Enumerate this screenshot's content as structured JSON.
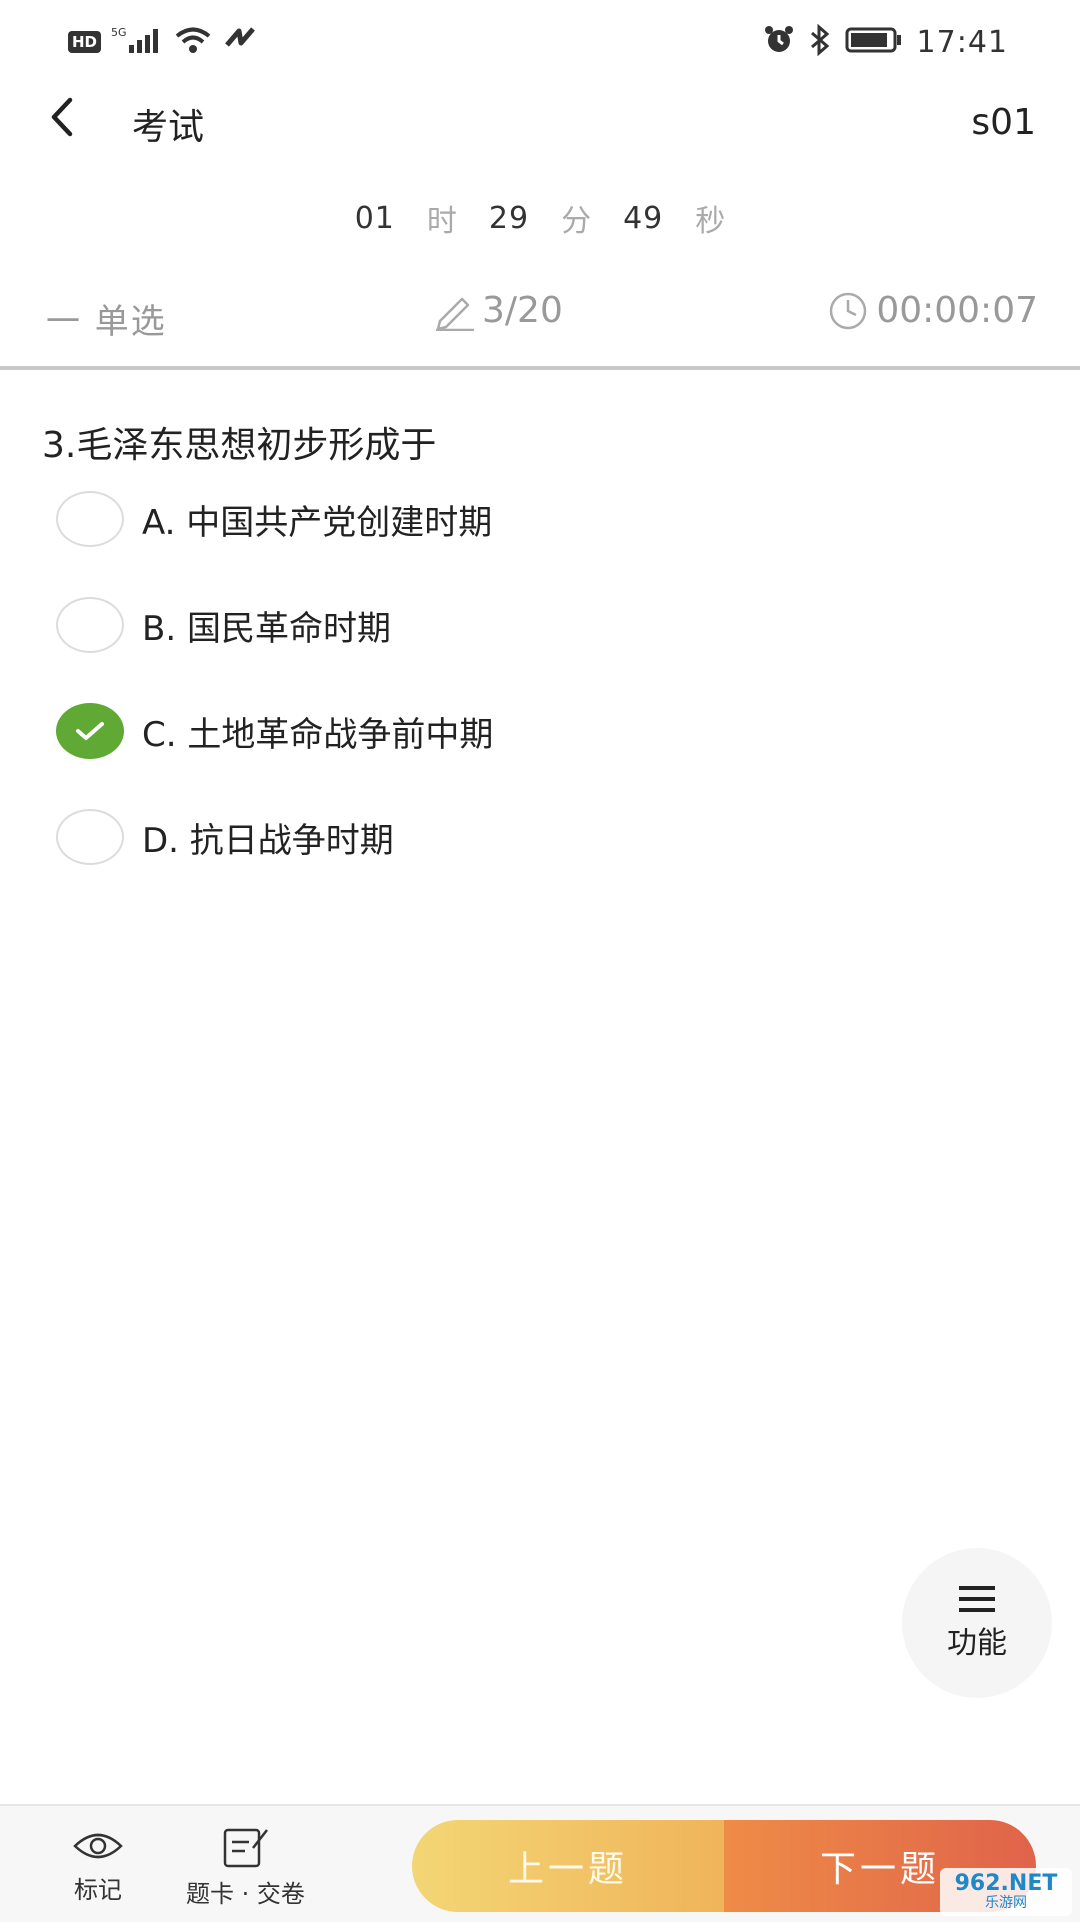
{
  "status_bar": {
    "left_badge": "HD",
    "network": "5G",
    "time": "17:41",
    "icons": [
      "signal-icon",
      "wifi-icon",
      "nfc-icon",
      "alarm-icon",
      "bluetooth-icon",
      "battery-icon"
    ]
  },
  "header": {
    "title": "考试",
    "user_code": "s01",
    "back_icon": "chevron-left-icon"
  },
  "countdown": {
    "hours": "01",
    "hours_unit": "时",
    "minutes": "29",
    "minutes_unit": "分",
    "seconds": "49",
    "seconds_unit": "秒"
  },
  "info": {
    "question_type": "一 单选",
    "progress": "3/20",
    "elapsed": "00:00:07"
  },
  "question": {
    "text": "3.毛泽东思想初步形成于",
    "options": [
      {
        "label": "A. 中国共产党创建时期",
        "selected": false
      },
      {
        "label": "B. 国民革命时期",
        "selected": false
      },
      {
        "label": "C. 土地革命战争前中期",
        "selected": true
      },
      {
        "label": "D. 抗日战争时期",
        "selected": false
      }
    ]
  },
  "function_button": {
    "label": "功能",
    "icon": "menu-icon"
  },
  "bottom_bar": {
    "mark_label": "标记",
    "card_label": "题卡 · 交卷",
    "prev_label": "上一题",
    "next_label": "下一题"
  },
  "watermark": {
    "main": "962.NET",
    "sub": "乐游网"
  },
  "colors": {
    "accent_green": "#5fa934",
    "prev_button": "#f0c060",
    "next_button": "#e0634a",
    "muted_text": "#999999"
  }
}
